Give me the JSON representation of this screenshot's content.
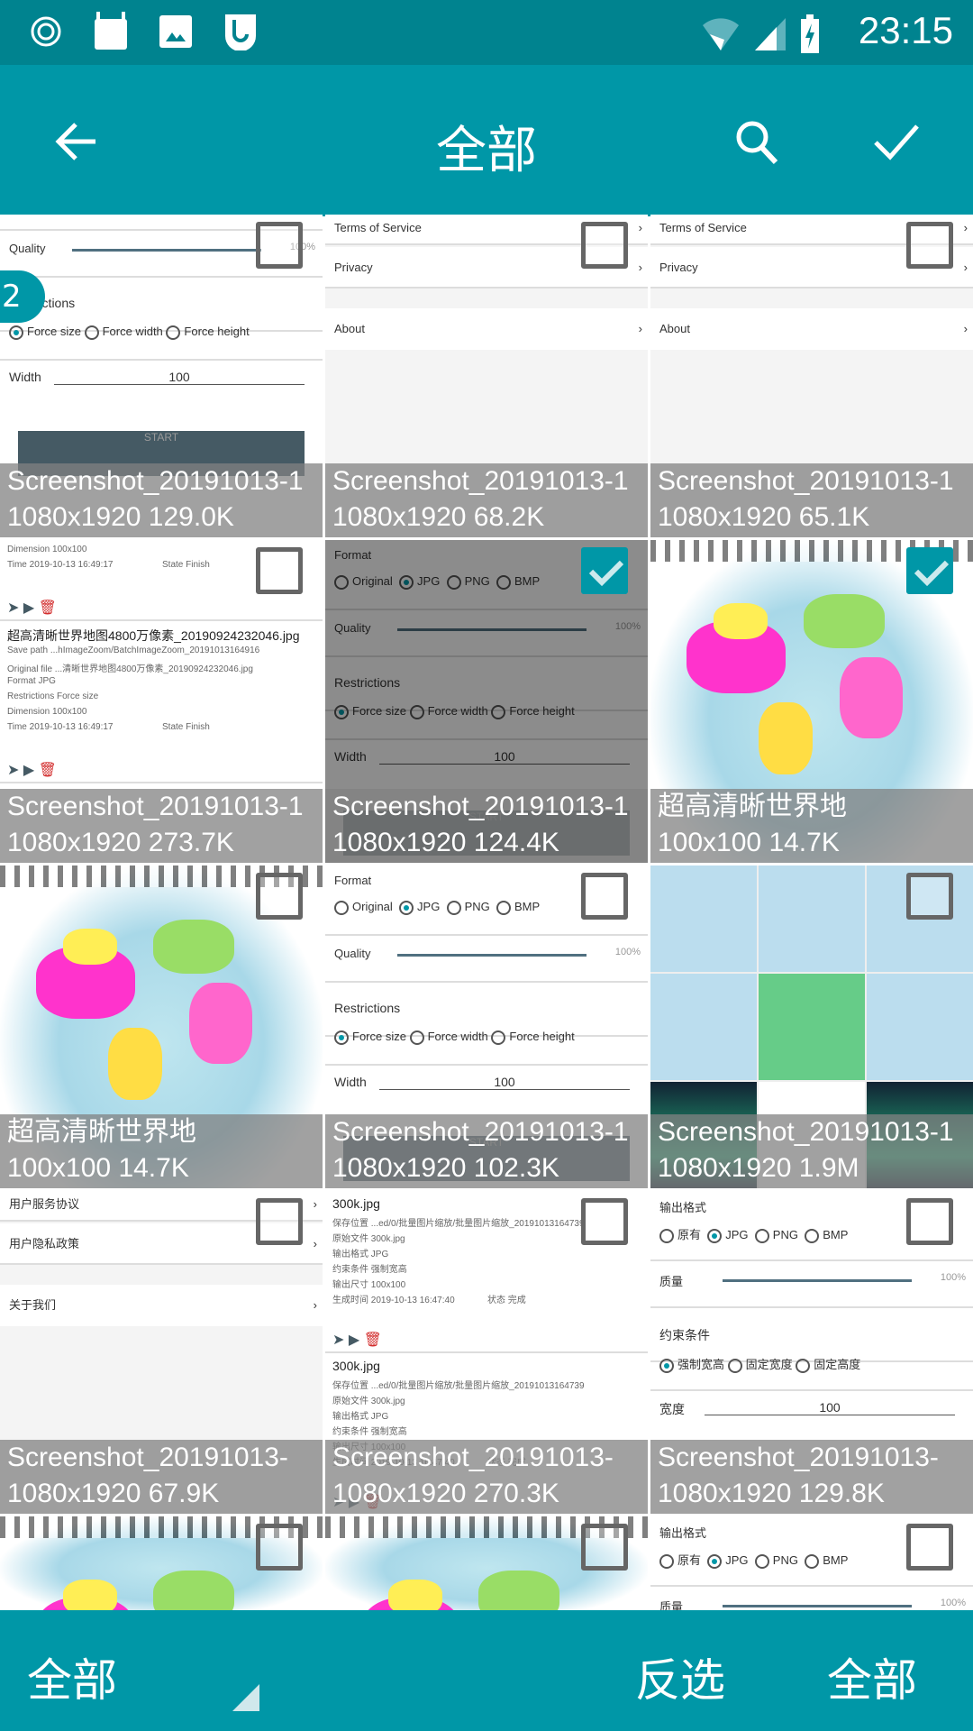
{
  "status_bar": {
    "time": "23:15",
    "icons": [
      "swirl-icon",
      "android-icon",
      "image-icon",
      "app-icon",
      "wifi-off-icon",
      "signal-icon",
      "battery-charging-icon"
    ]
  },
  "toolbar": {
    "title": "全部",
    "back_icon": "arrow-left-icon",
    "search_icon": "search-icon",
    "confirm_icon": "check-icon"
  },
  "badge": "2",
  "colors": {
    "primary": "#0097a7",
    "status": "#00838f"
  },
  "tiles": [
    {
      "type": "settings",
      "name": "Screenshot_20191013-1",
      "info": "1080x1920  129.0K",
      "checked": false
    },
    {
      "type": "links",
      "name": "Screenshot_20191013-1",
      "info": "1080x1920  68.2K",
      "checked": false
    },
    {
      "type": "links",
      "name": "Screenshot_20191013-1",
      "info": "1080x1920  65.1K",
      "checked": false
    },
    {
      "type": "log",
      "name": "Screenshot_20191013-1",
      "info": "1080x1920  273.7K",
      "checked": false
    },
    {
      "type": "settings",
      "name": "Screenshot_20191013-1",
      "info": "1080x1920  124.4K",
      "checked": true
    },
    {
      "type": "map",
      "name": "超高清晰世界地",
      "info": "100x100  14.7K",
      "checked": true
    },
    {
      "type": "map",
      "name": "超高清晰世界地",
      "info": "100x100  14.7K",
      "checked": false
    },
    {
      "type": "settings",
      "name": "Screenshot_20191013-1",
      "info": "1080x1920  102.3K",
      "checked": false
    },
    {
      "type": "collage",
      "name": "Screenshot_20191013-1",
      "info": "1080x1920  1.9M",
      "checked": false
    },
    {
      "type": "links_zh",
      "name": "Screenshot_20191013-",
      "info": "1080x1920  67.9K",
      "checked": false
    },
    {
      "type": "log_zh",
      "name": "Screenshot_20191013-",
      "info": "1080x1920  270.3K",
      "checked": false
    },
    {
      "type": "settings_zh",
      "name": "Screenshot_20191013-",
      "info": "1080x1920  129.8K",
      "checked": false
    },
    {
      "type": "map",
      "name": "",
      "info": "",
      "checked": false
    },
    {
      "type": "map",
      "name": "",
      "info": "",
      "checked": false
    },
    {
      "type": "settings_zh",
      "name": "",
      "info": "",
      "checked": false
    }
  ],
  "thumb_text": {
    "settings": {
      "format": "Format",
      "original": "Original",
      "jpg": "JPG",
      "png": "PNG",
      "bmp": "BMP",
      "quality": "Quality",
      "quality_value": "100%",
      "restrictions": "Restrictions",
      "force_size": "Force size",
      "force_width": "Force width",
      "force_height": "Force height",
      "width": "Width",
      "width_value": "100",
      "start": "START"
    },
    "links": {
      "terms": "Terms of Service",
      "privacy": "Privacy",
      "about": "About"
    },
    "log": {
      "title": "超高清晰世界地图4800万像素_20190924232046.jpg",
      "save_path": "Save path  ...hImageZoom/BatchImageZoom_20191013164916",
      "original": "Original file  ...清晰世界地图4800万像素_20190924232046.jpg",
      "format": "Format  JPG",
      "restrictions": "Restrictions  Force size",
      "dimension": "Dimension  100x100",
      "state": "State  Finish",
      "time": "Time  2019-10-13 16:49:17"
    },
    "links_zh": {
      "terms": "用户服务协议",
      "privacy": "用户隐私政策",
      "about": "关于我们"
    },
    "log_zh": {
      "title": "300k.jpg",
      "save_path": "保存位置  ...ed/0/批量图片缩放/批量图片缩放_20191013164739",
      "original": "原始文件  300k.jpg",
      "format": "输出格式  JPG",
      "restrictions": "约束条件  强制宽高",
      "dimension": "输出尺寸  100x100",
      "state": "状态  完成",
      "time": "生成时间  2019-10-13 16:47:40"
    },
    "settings_zh": {
      "format": "输出格式",
      "original": "原有",
      "jpg": "JPG",
      "png": "PNG",
      "bmp": "BMP",
      "quality": "质量",
      "quality_value": "100%",
      "restrictions": "约束条件",
      "force_size": "强制宽高",
      "force_width": "固定宽度",
      "force_height": "固定高度",
      "width": "宽度",
      "width_value": "100"
    }
  },
  "bottom_bar": {
    "left": "全部",
    "invert": "反选",
    "all": "全部"
  }
}
